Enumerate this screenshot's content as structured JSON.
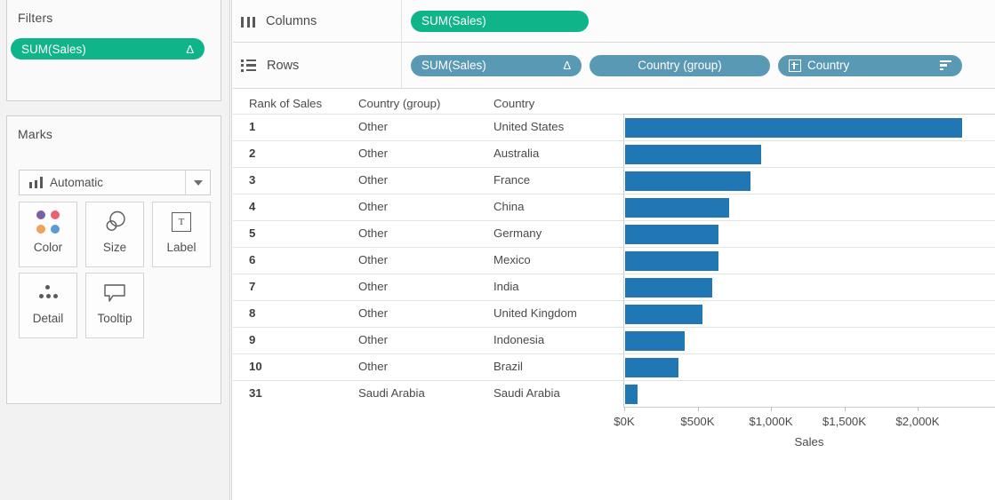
{
  "filters": {
    "title": "Filters",
    "pill": {
      "label": "SUM(Sales)",
      "glyph": "Δ",
      "color": "#0fb589"
    }
  },
  "marks": {
    "title": "Marks",
    "type_selector": {
      "value": "Automatic",
      "icon": "bar-chart-icon",
      "arrow": "chevron-down-icon"
    },
    "buttons": [
      {
        "label": "Color",
        "icon": "color-dots-icon"
      },
      {
        "label": "Size",
        "icon": "size-circles-icon"
      },
      {
        "label": "Label",
        "icon": "text-label-icon"
      },
      {
        "label": "Detail",
        "icon": "detail-dots-icon"
      },
      {
        "label": "Tooltip",
        "icon": "tooltip-balloon-icon"
      }
    ]
  },
  "shelves": {
    "columns": {
      "label": "Columns",
      "icon": "columns-icon",
      "pills": [
        {
          "label": "SUM(Sales)",
          "color": "#0fb589",
          "glyph": "",
          "type": "measure"
        }
      ]
    },
    "rows": {
      "label": "Rows",
      "icon": "rows-icon",
      "pills": [
        {
          "label": "SUM(Sales)",
          "color": "#5999b4",
          "glyph": "Δ",
          "type": "measure"
        },
        {
          "label": "Country (group)",
          "color": "#5999b4",
          "glyph": "",
          "type": "dimension"
        },
        {
          "label": "Country",
          "color": "#5999b4",
          "glyph": "sort-icon",
          "type": "dimension",
          "prefix_icon": "plus-box-icon"
        }
      ]
    }
  },
  "table": {
    "headers": [
      "Rank of Sales",
      "Country (group)",
      "Country"
    ],
    "rows": [
      {
        "rank": "1",
        "group": "Other",
        "country": "United States"
      },
      {
        "rank": "2",
        "group": "Other",
        "country": "Australia"
      },
      {
        "rank": "3",
        "group": "Other",
        "country": "France"
      },
      {
        "rank": "4",
        "group": "Other",
        "country": "China"
      },
      {
        "rank": "5",
        "group": "Other",
        "country": "Germany"
      },
      {
        "rank": "6",
        "group": "Other",
        "country": "Mexico"
      },
      {
        "rank": "7",
        "group": "Other",
        "country": "India"
      },
      {
        "rank": "8",
        "group": "Other",
        "country": "United Kingdom"
      },
      {
        "rank": "9",
        "group": "Other",
        "country": "Indonesia"
      },
      {
        "rank": "10",
        "group": "Other",
        "country": "Brazil"
      },
      {
        "rank": "31",
        "group": "Saudi Arabia",
        "country": "Saudi Arabia"
      }
    ]
  },
  "chart_data": {
    "type": "bar",
    "title": "",
    "xlabel": "Sales",
    "ylabel": "",
    "orientation": "horizontal",
    "bar_color": "#2077b4",
    "grid": false,
    "legend": "none",
    "xlim": [
      0,
      2300
    ],
    "units": "thousands of dollars",
    "tick_labels": [
      "$0K",
      "$500K",
      "$1,000K",
      "$1,500K",
      "$2,000K"
    ],
    "tick_values": [
      0,
      500,
      1000,
      1500,
      2000
    ],
    "categories": [
      "United States",
      "Australia",
      "France",
      "China",
      "Germany",
      "Mexico",
      "India",
      "United Kingdom",
      "Indonesia",
      "Brazil",
      "Saudi Arabia"
    ],
    "values": [
      2297,
      927,
      855,
      709,
      636,
      636,
      594,
      527,
      406,
      364,
      85
    ]
  }
}
